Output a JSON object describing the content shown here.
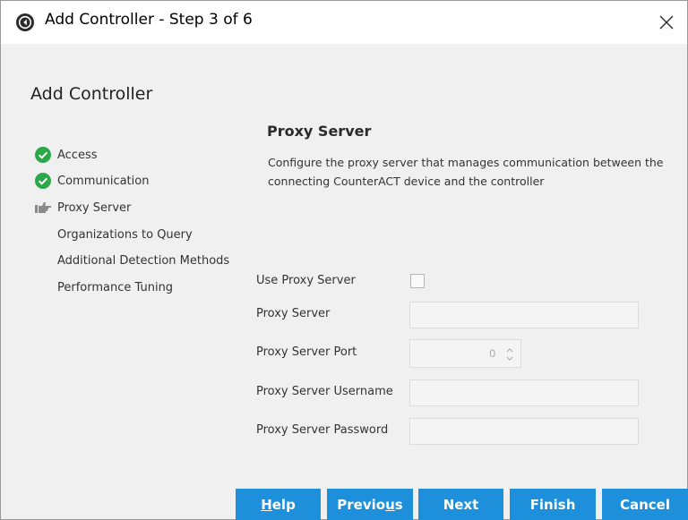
{
  "window": {
    "title": "Add Controller - Step 3 of 6",
    "close_icon": "close-icon"
  },
  "dialog": {
    "heading": "Add Controller"
  },
  "steps": [
    {
      "label": "Access",
      "status": "complete",
      "icon": "check-circle-icon"
    },
    {
      "label": "Communication",
      "status": "complete",
      "icon": "check-circle-icon"
    },
    {
      "label": "Proxy Server",
      "status": "current",
      "icon": "pointing-hand-icon"
    },
    {
      "label": "Organizations to Query",
      "status": "pending"
    },
    {
      "label": "Additional Detection Methods",
      "status": "pending"
    },
    {
      "label": "Performance Tuning",
      "status": "pending"
    }
  ],
  "section": {
    "title": "Proxy Server",
    "description": "Configure the proxy server that manages communication between the connecting CounterACT device and the controller"
  },
  "form": {
    "use_proxy_label": "Use Proxy Server",
    "use_proxy_checked": false,
    "proxy_server_label": "Proxy Server",
    "proxy_server_value": "",
    "proxy_port_label": "Proxy Server Port",
    "proxy_port_value": "0",
    "proxy_username_label": "Proxy Server Username",
    "proxy_username_value": "",
    "proxy_password_label": "Proxy Server Password",
    "proxy_password_value": ""
  },
  "buttons": {
    "help_mnemonic": "H",
    "help_rest": "elp",
    "previous_start": "Previo",
    "previous_mnemonic": "u",
    "previous_end": "s",
    "next": "Next",
    "finish": "Finish",
    "cancel": "Cancel"
  },
  "colors": {
    "accent": "#1e8fdb",
    "check_green": "#2aa84a"
  }
}
